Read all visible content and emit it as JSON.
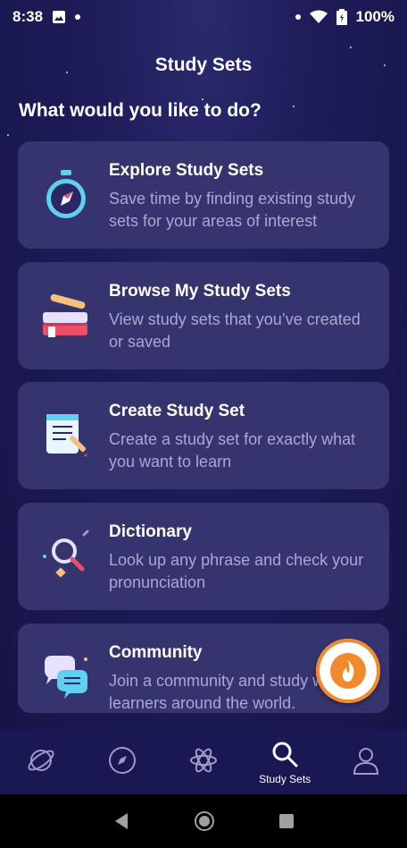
{
  "status": {
    "time": "8:38",
    "battery": "100%"
  },
  "header": {
    "title": "Study Sets",
    "prompt": "What would you like to do?"
  },
  "cards": [
    {
      "title": "Explore Study Sets",
      "desc": "Save time by finding existing study sets for your areas of interest",
      "icon": "compass-icon"
    },
    {
      "title": "Browse My Study Sets",
      "desc": "View study sets that you’ve created or saved",
      "icon": "books-icon"
    },
    {
      "title": "Create Study Set",
      "desc": "Create a study set for exactly what you want to learn",
      "icon": "notepad-icon"
    },
    {
      "title": "Dictionary",
      "desc": "Look up any phrase and check your pronunciation",
      "icon": "magnifier-icon"
    },
    {
      "title": "Community",
      "desc": "Join a community and study with learners around the world.",
      "icon": "chat-bubbles-icon"
    }
  ],
  "nav": {
    "items": [
      {
        "name": "planet",
        "label": ""
      },
      {
        "name": "compass",
        "label": ""
      },
      {
        "name": "atom",
        "label": ""
      },
      {
        "name": "study-sets",
        "label": "Study Sets"
      },
      {
        "name": "profile",
        "label": ""
      }
    ]
  },
  "colors": {
    "card": "#36346e",
    "accent": "#f08a2c",
    "desc": "#a9a7d4"
  }
}
